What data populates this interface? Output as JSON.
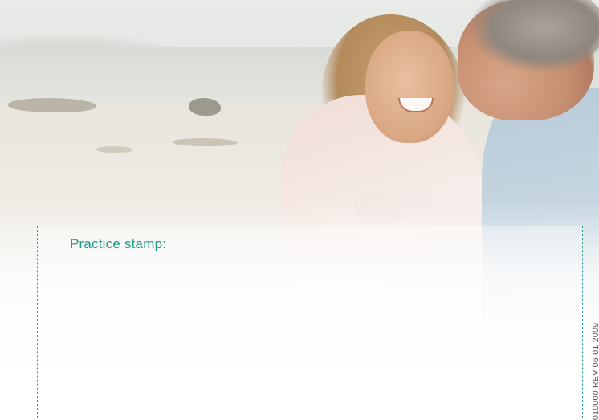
{
  "stamp": {
    "label": "Practice stamp:",
    "border_color": "#1aa38a",
    "text_color": "#1a9c86"
  },
  "reference": {
    "code": "010000 REV 06 01 2009"
  },
  "photo": {
    "icon": "beach-couple-photo"
  }
}
